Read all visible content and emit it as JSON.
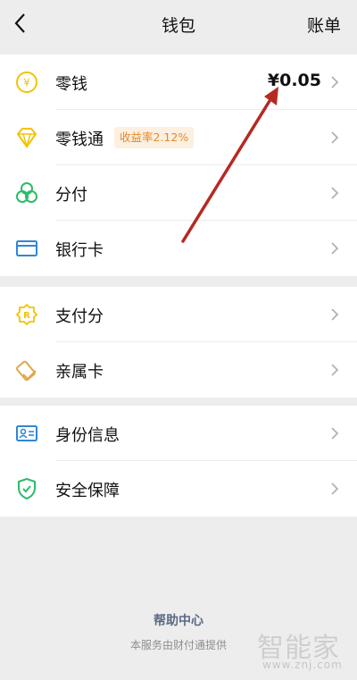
{
  "header": {
    "title": "钱包",
    "bill_label": "账单"
  },
  "groups": [
    {
      "items": [
        {
          "label": "零钱",
          "amount": "¥0.05",
          "icon": "yuan-coin-icon"
        },
        {
          "label": "零钱通",
          "badge": "收益率2.12%",
          "icon": "diamond-icon"
        },
        {
          "label": "分付",
          "icon": "fenfu-icon"
        },
        {
          "label": "银行卡",
          "icon": "bank-card-icon"
        }
      ]
    },
    {
      "items": [
        {
          "label": "支付分",
          "icon": "payscore-badge-icon"
        },
        {
          "label": "亲属卡",
          "icon": "family-card-icon"
        }
      ]
    },
    {
      "items": [
        {
          "label": "身份信息",
          "icon": "id-card-icon"
        },
        {
          "label": "安全保障",
          "icon": "shield-check-icon"
        }
      ]
    }
  ],
  "footer": {
    "help_label": "帮助中心",
    "provider_text": "本服务由财付通提供"
  },
  "watermark": {
    "text": "智能家",
    "url": "www.znj.com"
  },
  "colors": {
    "gold": "#f2c300",
    "green": "#2dbb6b",
    "blue": "#2f86d9",
    "orange": "#e0a84c",
    "annotation_arrow": "#b52a22"
  }
}
